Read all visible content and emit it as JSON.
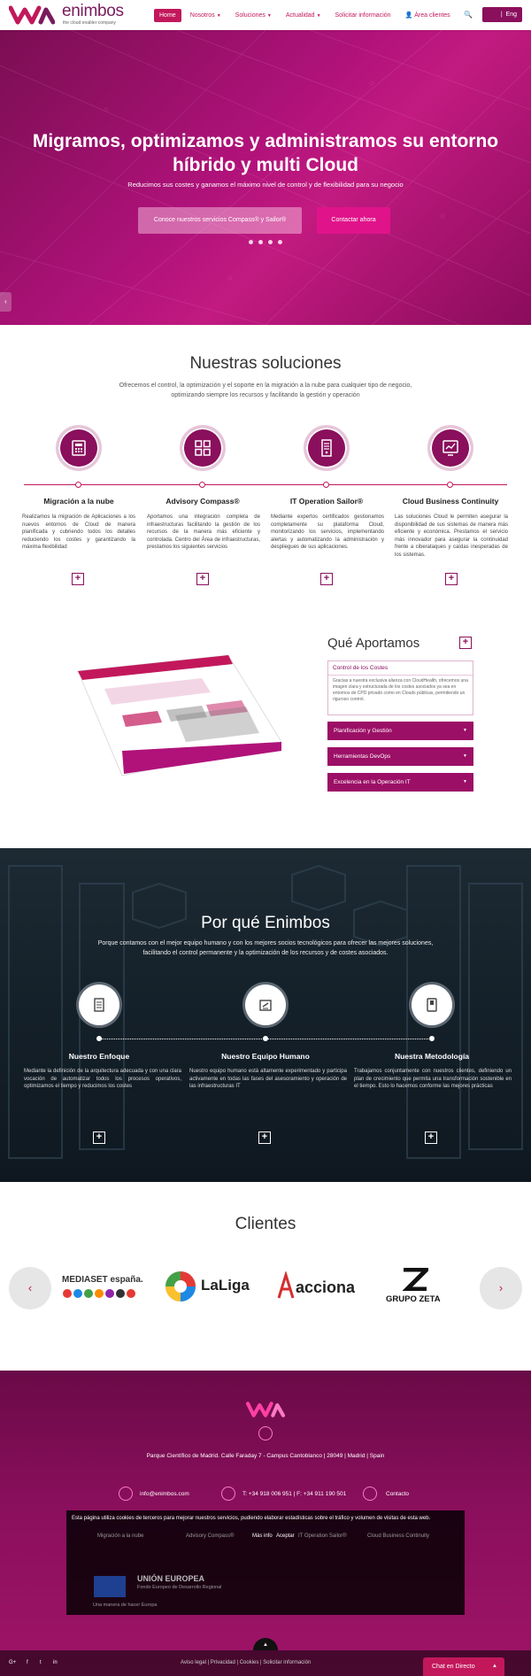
{
  "header": {
    "logo_text": "enimbos",
    "logo_tagline": "the cloud enabler company",
    "nav": [
      "Home",
      "Nosotros",
      "Soluciones",
      "Actualidad",
      "Solicitar información",
      "Área clientes"
    ],
    "lang": "Eng"
  },
  "hero": {
    "title_line1": "Migramos, optimizamos y administramos su entorno",
    "title_line2": "híbrido y multi Cloud",
    "subtitle": "Reducimos sus costes y ganamos el máximo nivel de control y de flexibilidad para su negocio",
    "btn_services": "Conoce nuestros servicios Compass® y Sailor®",
    "btn_contact": "Contactar ahora"
  },
  "soluciones": {
    "title": "Nuestras soluciones",
    "desc": "Ofrecemos el control, la optimización y el soporte en la migración a la nube para cualquier tipo de negocio, optimizando siempre los recursos y facilitando la gestión y operación",
    "items": [
      {
        "title": "Migración a la nube",
        "text": "Realizamos la migración de Aplicaciones a los nuevos entornos de Cloud de manera planificada y cubriendo todos los detalles reduciendo los costes y garantizando la máxima flexibilidad"
      },
      {
        "title": "Advisory Compass®",
        "text": "Aportamos una integración completa de infraestructuras facilitando la gestión de los recursos de la manera más eficiente y controlada. Centro del Área de infraestructuras, prestamos los siguientes servicios"
      },
      {
        "title": "IT Operation Sailor®",
        "text": "Mediante expertos certificados gestionamos completamente su plataforma Cloud, monitorizando los servicios, implementando alertas y automatizando la administración y despliegues de sus aplicaciones."
      },
      {
        "title": "Cloud Business Continuity",
        "text": "Las soluciones Cloud le permiten asegurar la disponibilidad de sus sistemas de manera más eficiente y económica. Prestamos el servicio más innovador para asegurar la continuidad frente a ciberataques y caídas inesperadas de los sistemas."
      }
    ]
  },
  "aportamos": {
    "title": "Qué Aportamos",
    "open_title": "Control de los Costes",
    "open_text": "Gracias a nuestra exclusiva alianza con CloudHealth, ofrecemos una imagen clara y estructurada de los costes asociados ya sea en entornos de CPD privado como en Clouds públicas, permitiendo un riguroso control.",
    "items": [
      "Planificación y Gestión",
      "Herramientas DevOps",
      "Excelencia en la Operación IT"
    ]
  },
  "why": {
    "title": "Por qué Enimbos",
    "desc_line1": "Porque contamos con el mejor equipo humano y con los mejores socios tecnológicos para ofrecer las mejores soluciones,",
    "desc_line2": "facilitando el control permanente y la optimización de los recursos y de costes asociados.",
    "items": [
      {
        "title": "Nuestro Enfoque",
        "text": "Mediante la definición de la arquitectura adecuada y con una clara vocación de automatizar todos los procesos operativos, optimizamos el tiempo y reducimos los costes"
      },
      {
        "title": "Nuestro Equipo Humano",
        "text": "Nuestro equipo humano está altamente experimentado y participa activamente en todas las fases del asesoramiento y operación de las infraestructuras IT"
      },
      {
        "title": "Nuestra Metodología",
        "text": "Trabajamos conjuntamente con nuestros clientes, definiendo un plan de crecimiento que permita una transformación sostenible en el tiempo. Esto lo hacemos conforme las mejores prácticas"
      }
    ]
  },
  "clientes": {
    "title": "Clientes",
    "logos": [
      "MEDIASET españa.",
      "LaLiga",
      "acciona",
      "GRUPO ZETA"
    ]
  },
  "footer": {
    "address": "Parque Científico de Madrid. Calle Faraday 7 - Campus Cantoblanco | 28049 | Madrid | Spain",
    "email": "info@enimbos.com",
    "phone": "T: +34 918 006 951 | F: +34 911 190 501",
    "contact": "Contacto",
    "cookie_text": "Esta página utiliza cookies de terceros para mejorar nuestros servicios, pudiendo elaborar estadísticas sobre el tráfico y volumen de visitas de esta web.",
    "cookie_items": [
      "Migración a la nube",
      "Advisory Compass®",
      "Más info",
      "Aceptar",
      "IT Operation Sailor®",
      "Cloud Business Continuity"
    ],
    "eu_title": "UNIÓN EUROPEA",
    "eu_fund": "Fondo Europeo de Desarrollo Regional",
    "eu_slogan": "Una manera de hacer Europa",
    "legal_links": "Aviso legal  |  Privacidad  |  Cookies  |  Solicitar información",
    "social": [
      "G+",
      "f",
      "t",
      "in"
    ],
    "chat": "Chat en Directo"
  }
}
